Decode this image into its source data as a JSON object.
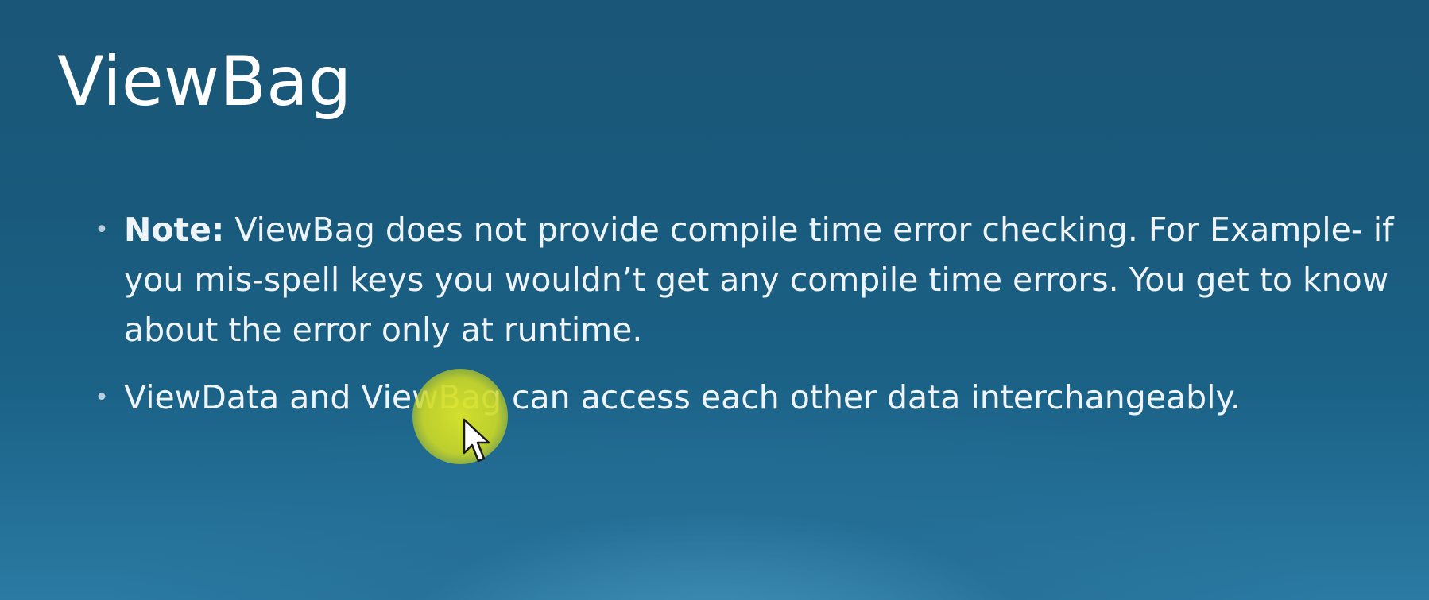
{
  "slide": {
    "title": "ViewBag",
    "bullets": [
      {
        "label": "Note:",
        "text": " ViewBag does not provide compile time error checking. For Example- if you mis-spell keys you wouldn’t get any compile time errors. You get to know about the error only at runtime."
      },
      {
        "label": "",
        "text": "ViewData and ViewBag can access each other data interchangeably."
      }
    ]
  },
  "colors": {
    "background_top": "#1a5677",
    "background_bottom": "#2a7aa3",
    "cursor_highlight": "#d3dc28",
    "text": "#ffffff"
  },
  "icons": {
    "cursor": "mouse-pointer-icon",
    "bullet": "bullet-dot-icon"
  }
}
